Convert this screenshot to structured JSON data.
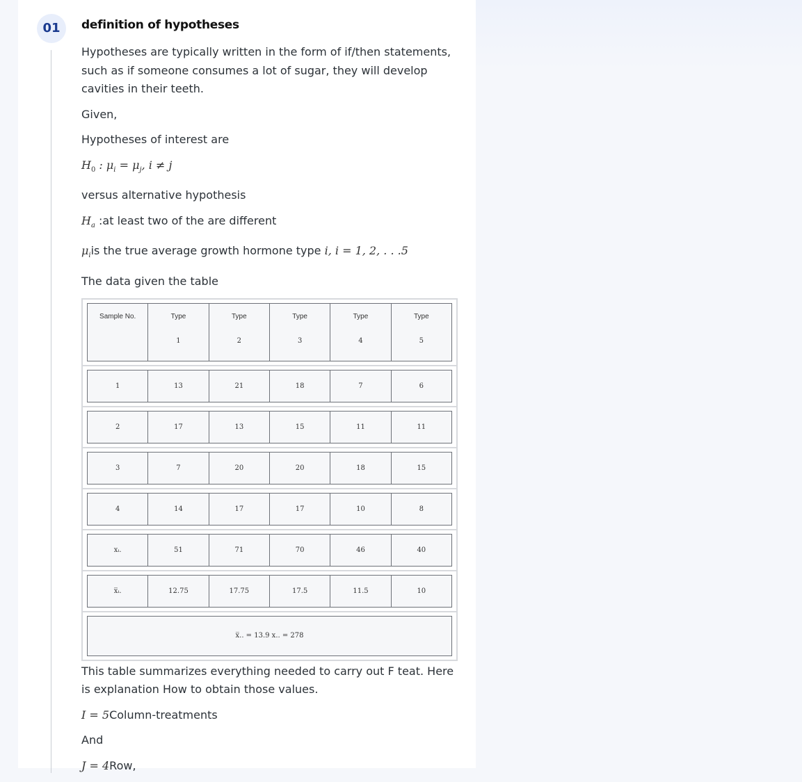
{
  "step": {
    "number": "01",
    "title": "definition of hypotheses"
  },
  "paragraphs": {
    "intro": "Hypotheses are typically written in the form of if/then statements, such as if someone consumes a lot of sugar, they will develop cavities in their teeth.",
    "given": "Given,",
    "interest": "Hypotheses of interest are",
    "versus": "versus alternative hypothesis",
    "ha_text": ":at least two of the are different",
    "mu_text": "is the true average growth hormone type ",
    "data_given": "The data given the table",
    "summary": "This table summarizes everything needed to carry out F teat. Here is explanation How to obtain those values.",
    "i_text": "Column-treatments",
    "and": "And",
    "j_text": "Row,"
  },
  "math": {
    "h0_sym": "H",
    "h0_sub": "0",
    "h0_rest": " : μ",
    "h0_i": "i",
    "h0_eq": " = μ",
    "h0_j": "j",
    "h0_tail": ", i ≠ j",
    "ha_sym": "H",
    "ha_sub": "a",
    "mu_sym": "μ",
    "mu_sub": "i",
    "mu_range": "i, i = 1, 2, . . .5",
    "i_eq": "I = 5",
    "j_eq": "J = 4"
  },
  "table": {
    "header": [
      {
        "l1": "Sample No.",
        "l2": ""
      },
      {
        "l1": "Type",
        "l2": "1"
      },
      {
        "l1": "Type",
        "l2": "2"
      },
      {
        "l1": "Type",
        "l2": "3"
      },
      {
        "l1": "Type",
        "l2": "4"
      },
      {
        "l1": "Type",
        "l2": "5"
      }
    ],
    "rows": [
      [
        "1",
        "13",
        "21",
        "18",
        "7",
        "6"
      ],
      [
        "2",
        "17",
        "13",
        "15",
        "11",
        "11"
      ],
      [
        "3",
        "7",
        "20",
        "20",
        "18",
        "15"
      ],
      [
        "4",
        "14",
        "17",
        "17",
        "10",
        "8"
      ],
      [
        "xᵢ.",
        "51",
        "71",
        "70",
        "46",
        "40"
      ],
      [
        "x̅ᵢ.",
        "12.75",
        "17.75",
        "17.5",
        "11.5",
        "10"
      ]
    ],
    "summary": "x̅.. = 13.9  x.. = 278"
  }
}
